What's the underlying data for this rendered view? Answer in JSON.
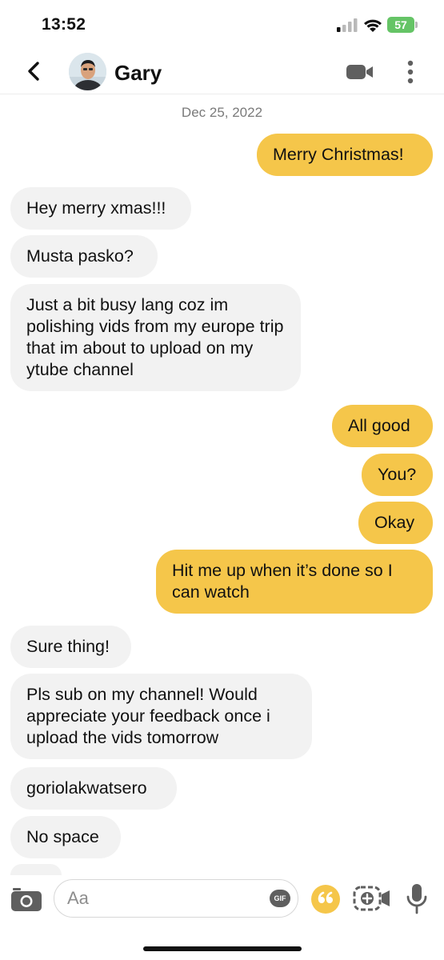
{
  "status_bar": {
    "time": "13:52",
    "battery": "57"
  },
  "header": {
    "contact_name": "Gary"
  },
  "conversation": {
    "date": "Dec 25, 2022",
    "messages": [
      {
        "dir": "out",
        "text": "Merry Christmas!"
      },
      {
        "dir": "in",
        "text": "Hey merry xmas!!!"
      },
      {
        "dir": "in",
        "text": "Musta pasko?"
      },
      {
        "dir": "in",
        "text": "Just a bit busy lang coz im polishing vids from my europe trip that im about to upload on my ytube channel"
      },
      {
        "dir": "out",
        "text": "All good"
      },
      {
        "dir": "out",
        "text": "You?"
      },
      {
        "dir": "out",
        "text": "Okay"
      },
      {
        "dir": "out",
        "text": "Hit me up when it’s done so I can watch"
      },
      {
        "dir": "in",
        "text": "Sure thing!"
      },
      {
        "dir": "in",
        "text": "Pls sub on my channel! Would appreciate your feedback once i upload the vids tomorrow"
      },
      {
        "dir": "in",
        "text": "goriolakwatsero"
      },
      {
        "dir": "in",
        "text": "No space"
      }
    ]
  },
  "composer": {
    "placeholder": "Aa",
    "value": "",
    "gif_label": "GIF"
  },
  "colors": {
    "outgoing_bubble": "#f5c64a",
    "incoming_bubble": "#f2f2f2",
    "accent": "#f5c64a",
    "battery": "#65c466"
  },
  "icons": [
    "back-icon",
    "video-call-icon",
    "more-icon",
    "camera-icon",
    "gif-icon",
    "quote-icon",
    "effects-icon",
    "mic-icon",
    "signal-icon",
    "wifi-icon",
    "battery-icon"
  ]
}
